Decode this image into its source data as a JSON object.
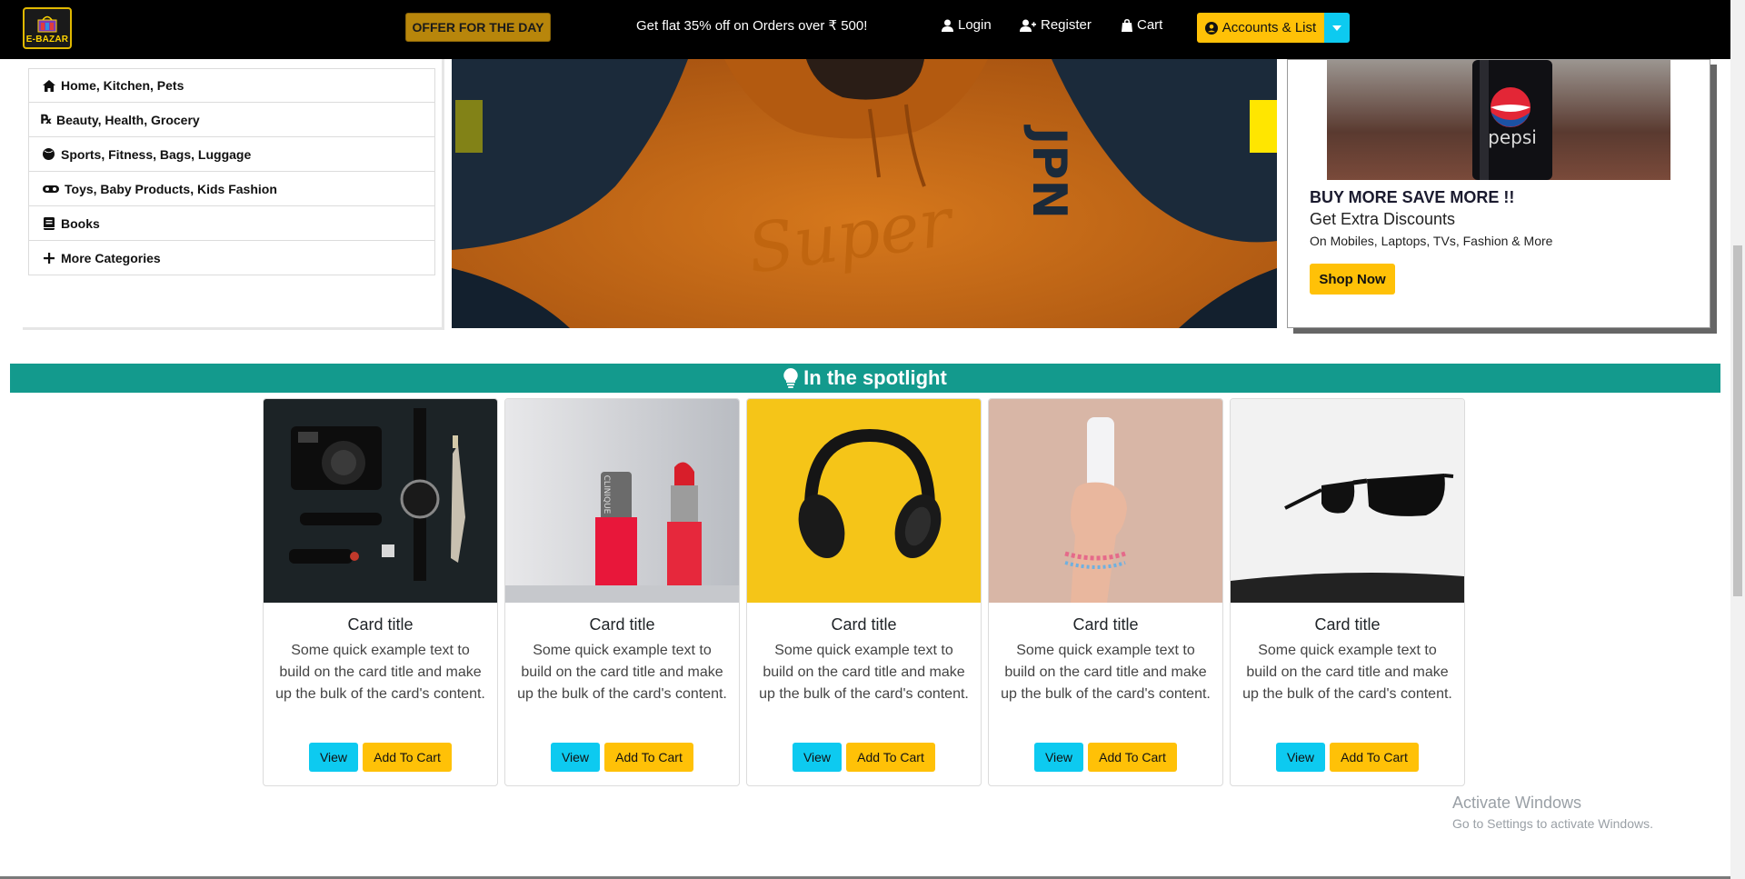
{
  "nav": {
    "logo_text": "E-BAZAR",
    "offer_label": "OFFER FOR THE DAY",
    "promo_text": "Get flat 35% off on Orders over ₹ 500!",
    "login_label": "Login",
    "register_label": "Register",
    "cart_label": "Cart",
    "accounts_label": "Accounts & List"
  },
  "sidebar": {
    "items": [
      {
        "label": "Home, Kitchen, Pets",
        "icon": "home-icon"
      },
      {
        "label": "Beauty, Health, Grocery",
        "icon": "prescription-icon"
      },
      {
        "label": "Sports, Fitness, Bags, Luggage",
        "icon": "ball-icon"
      },
      {
        "label": "Toys, Baby Products, Kids Fashion",
        "icon": "mask-icon"
      },
      {
        "label": "Books",
        "icon": "book-icon"
      },
      {
        "label": "More Categories",
        "icon": "plus-icon"
      }
    ]
  },
  "ad": {
    "brand_text": "pepsi",
    "title": "BUY MORE SAVE MORE !!",
    "subtitle": "Get Extra Discounts",
    "small_text": "On Mobiles, Laptops, TVs, Fashion & More",
    "button_label": "Shop Now"
  },
  "spotlight": {
    "heading": "In the spotlight"
  },
  "cards": [
    {
      "title": "Card title",
      "text": "Some quick example text to build on the card title and make up the bulk of the card's content.",
      "view": "View",
      "add": "Add To Cart",
      "image": "camera-flatlay"
    },
    {
      "title": "Card title",
      "text": "Some quick example text to build on the card title and make up the bulk of the card's content.",
      "view": "View",
      "add": "Add To Cart",
      "image": "cosmetics"
    },
    {
      "title": "Card title",
      "text": "Some quick example text to build on the card title and make up the bulk of the card's content.",
      "view": "View",
      "add": "Add To Cart",
      "image": "headphones"
    },
    {
      "title": "Card title",
      "text": "Some quick example text to build on the card title and make up the bulk of the card's content.",
      "view": "View",
      "add": "Add To Cart",
      "image": "hand-bottle"
    },
    {
      "title": "Card title",
      "text": "Some quick example text to build on the card title and make up the bulk of the card's content.",
      "view": "View",
      "add": "Add To Cart",
      "image": "sunglasses"
    }
  ],
  "watermark": {
    "title": "Activate Windows",
    "subtitle": "Go to Settings to activate Windows."
  },
  "colors": {
    "navbar": "#000000",
    "accent_yellow": "#ffc107",
    "accent_cyan": "#0dcaf0",
    "spotlight_bar": "#139a8d",
    "offer_button": "#b8860b"
  }
}
